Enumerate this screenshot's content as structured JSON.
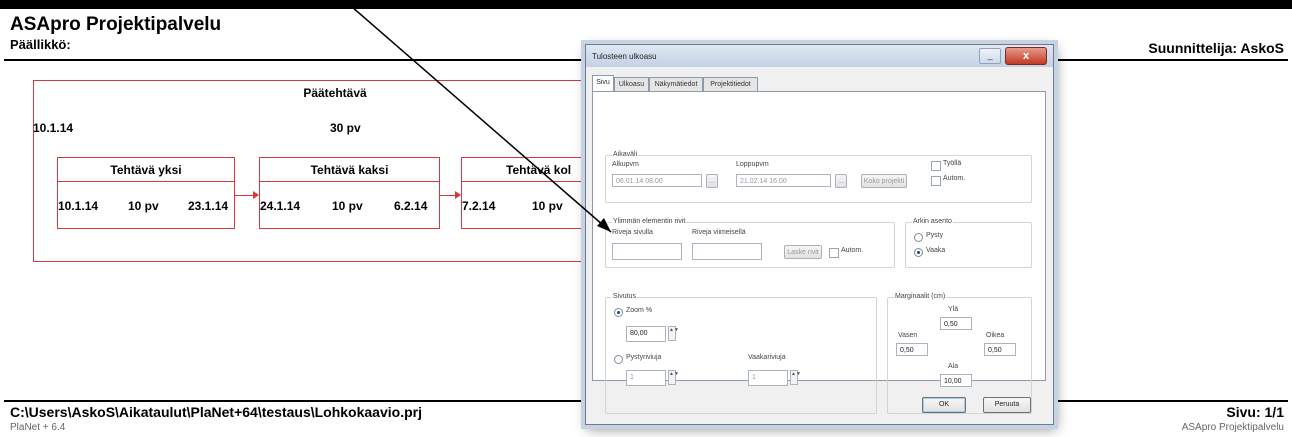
{
  "report": {
    "title": "ASApro Projektipalvelu",
    "manager_label": "Päällikkö:",
    "designer_label": "Suunnittelija: AskoS",
    "file_path": "C:\\Users\\AskoS\\Aikataulut\\PlaNet+64\\testaus\\Lohkokaavio.prj",
    "page_number": "Sivu: 1/1",
    "footer_left": "PlaNet + 6.4",
    "footer_right": "ASApro Projektipalvelu"
  },
  "diagram": {
    "main_task": {
      "name": "Päätehtävä",
      "start": "10.1.14",
      "duration": "30 pv"
    },
    "tasks": [
      {
        "name": "Tehtävä yksi",
        "start": "10.1.14",
        "duration": "10 pv",
        "end": "23.1.14"
      },
      {
        "name": "Tehtävä kaksi",
        "start": "24.1.14",
        "duration": "10 pv",
        "end": "6.2.14"
      },
      {
        "name": "Tehtävä kol",
        "start": "7.2.14",
        "duration": "10 pv",
        "end": ""
      }
    ],
    "colors": {
      "box_border": "#d8383c"
    }
  },
  "dialog": {
    "title": "Tulosteen ulkoasu",
    "close_glyph": "x",
    "tabs": [
      "Sivu",
      "Ulkoasu",
      "Näkymätiedot",
      "Projektitiedot"
    ],
    "active_tab": "Sivu",
    "aikavali": {
      "group_label": "Aikaväli",
      "start_label": "Alkupvm",
      "start_value": "06.01.14 08.00",
      "end_label": "Loppupvm",
      "end_value": "21.02.14 16.00",
      "browse_label": "...",
      "whole_project_button": "Koko projekti",
      "tyolla_label": "Työllä",
      "autom_label": "Autom."
    },
    "elements": {
      "group_label": "Ylimmän elementin rivit",
      "first_row_label": "Riveja sivulla",
      "last_row_label": "Riveja viimeisellä",
      "compute_button": "Laske rivit",
      "autom_label": "Autom."
    },
    "orientation": {
      "group_label": "Arkin asento",
      "portrait_label": "Pysty",
      "landscape_label": "Vaaka",
      "selected": "Vaaka"
    },
    "pages": {
      "group_label": "Sivutus",
      "zoom_label": "Zoom %",
      "zoom_value": "80,00",
      "vertical_label": "Pystyriviuja",
      "vertical_value": "1",
      "horizontal_label": "Vaakariviuja",
      "horizontal_value": "1",
      "selected": "Zoom %"
    },
    "margins": {
      "group_label": "Marginaalit (cm)",
      "top_label": "Ylä",
      "top_value": "0,50",
      "left_label": "Vasen",
      "left_value": "0,50",
      "right_label": "Oikea",
      "right_value": "0,50",
      "bottom_label": "Ala",
      "bottom_value": "10,00"
    },
    "ok_label": "OK",
    "cancel_label": "Peruuta"
  }
}
